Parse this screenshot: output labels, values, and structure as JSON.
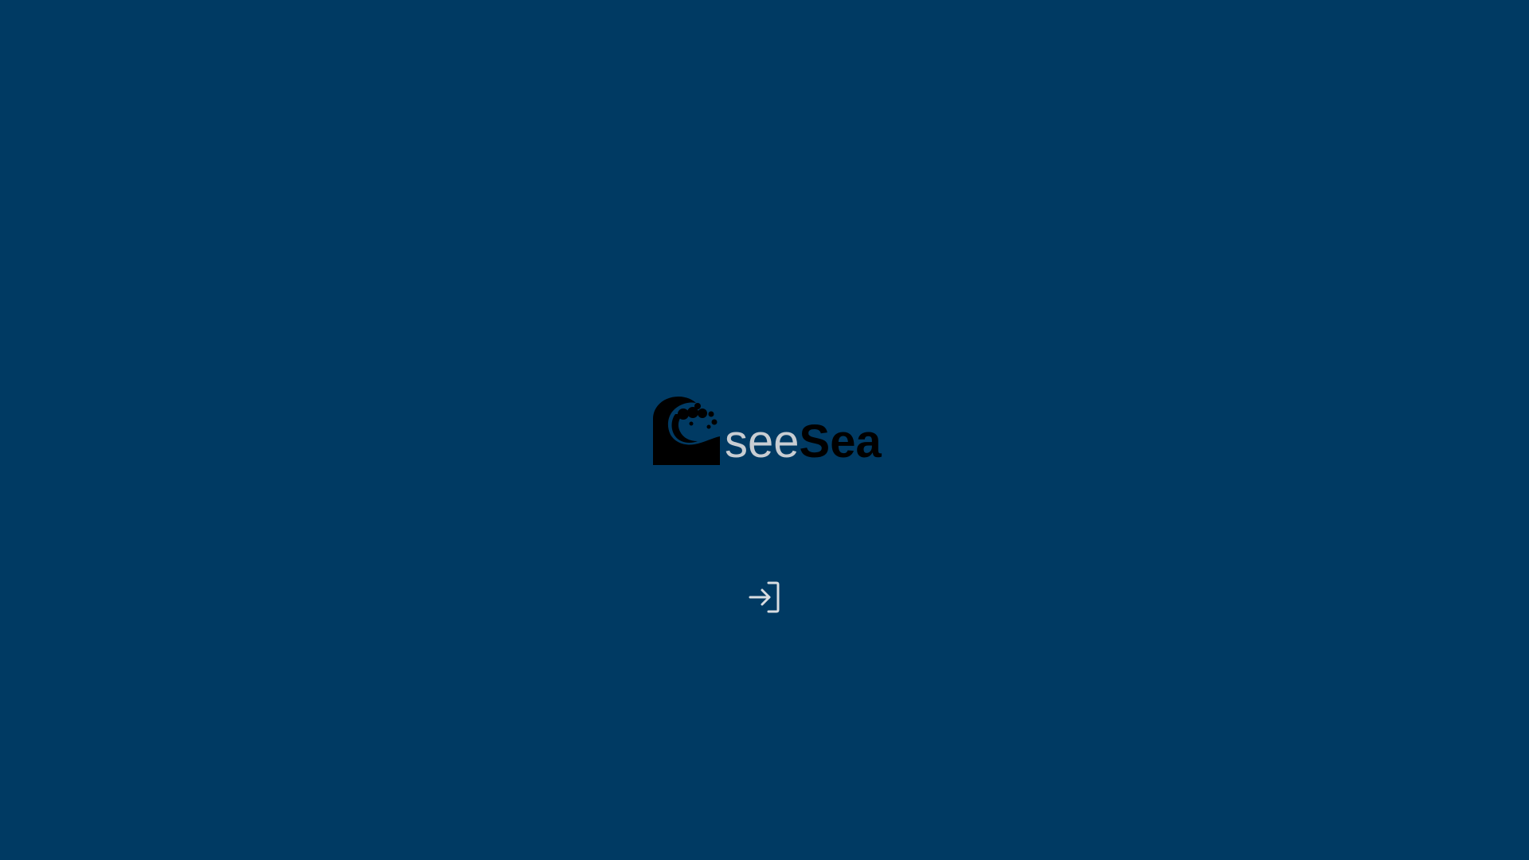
{
  "brand": {
    "name_part1": "see",
    "name_part2": "Sea",
    "logo_icon": "wave-icon"
  },
  "login": {
    "icon": "login-icon"
  },
  "colors": {
    "background": "#003a63",
    "text_light": "#c8cdd2",
    "text_dark": "#000000"
  }
}
